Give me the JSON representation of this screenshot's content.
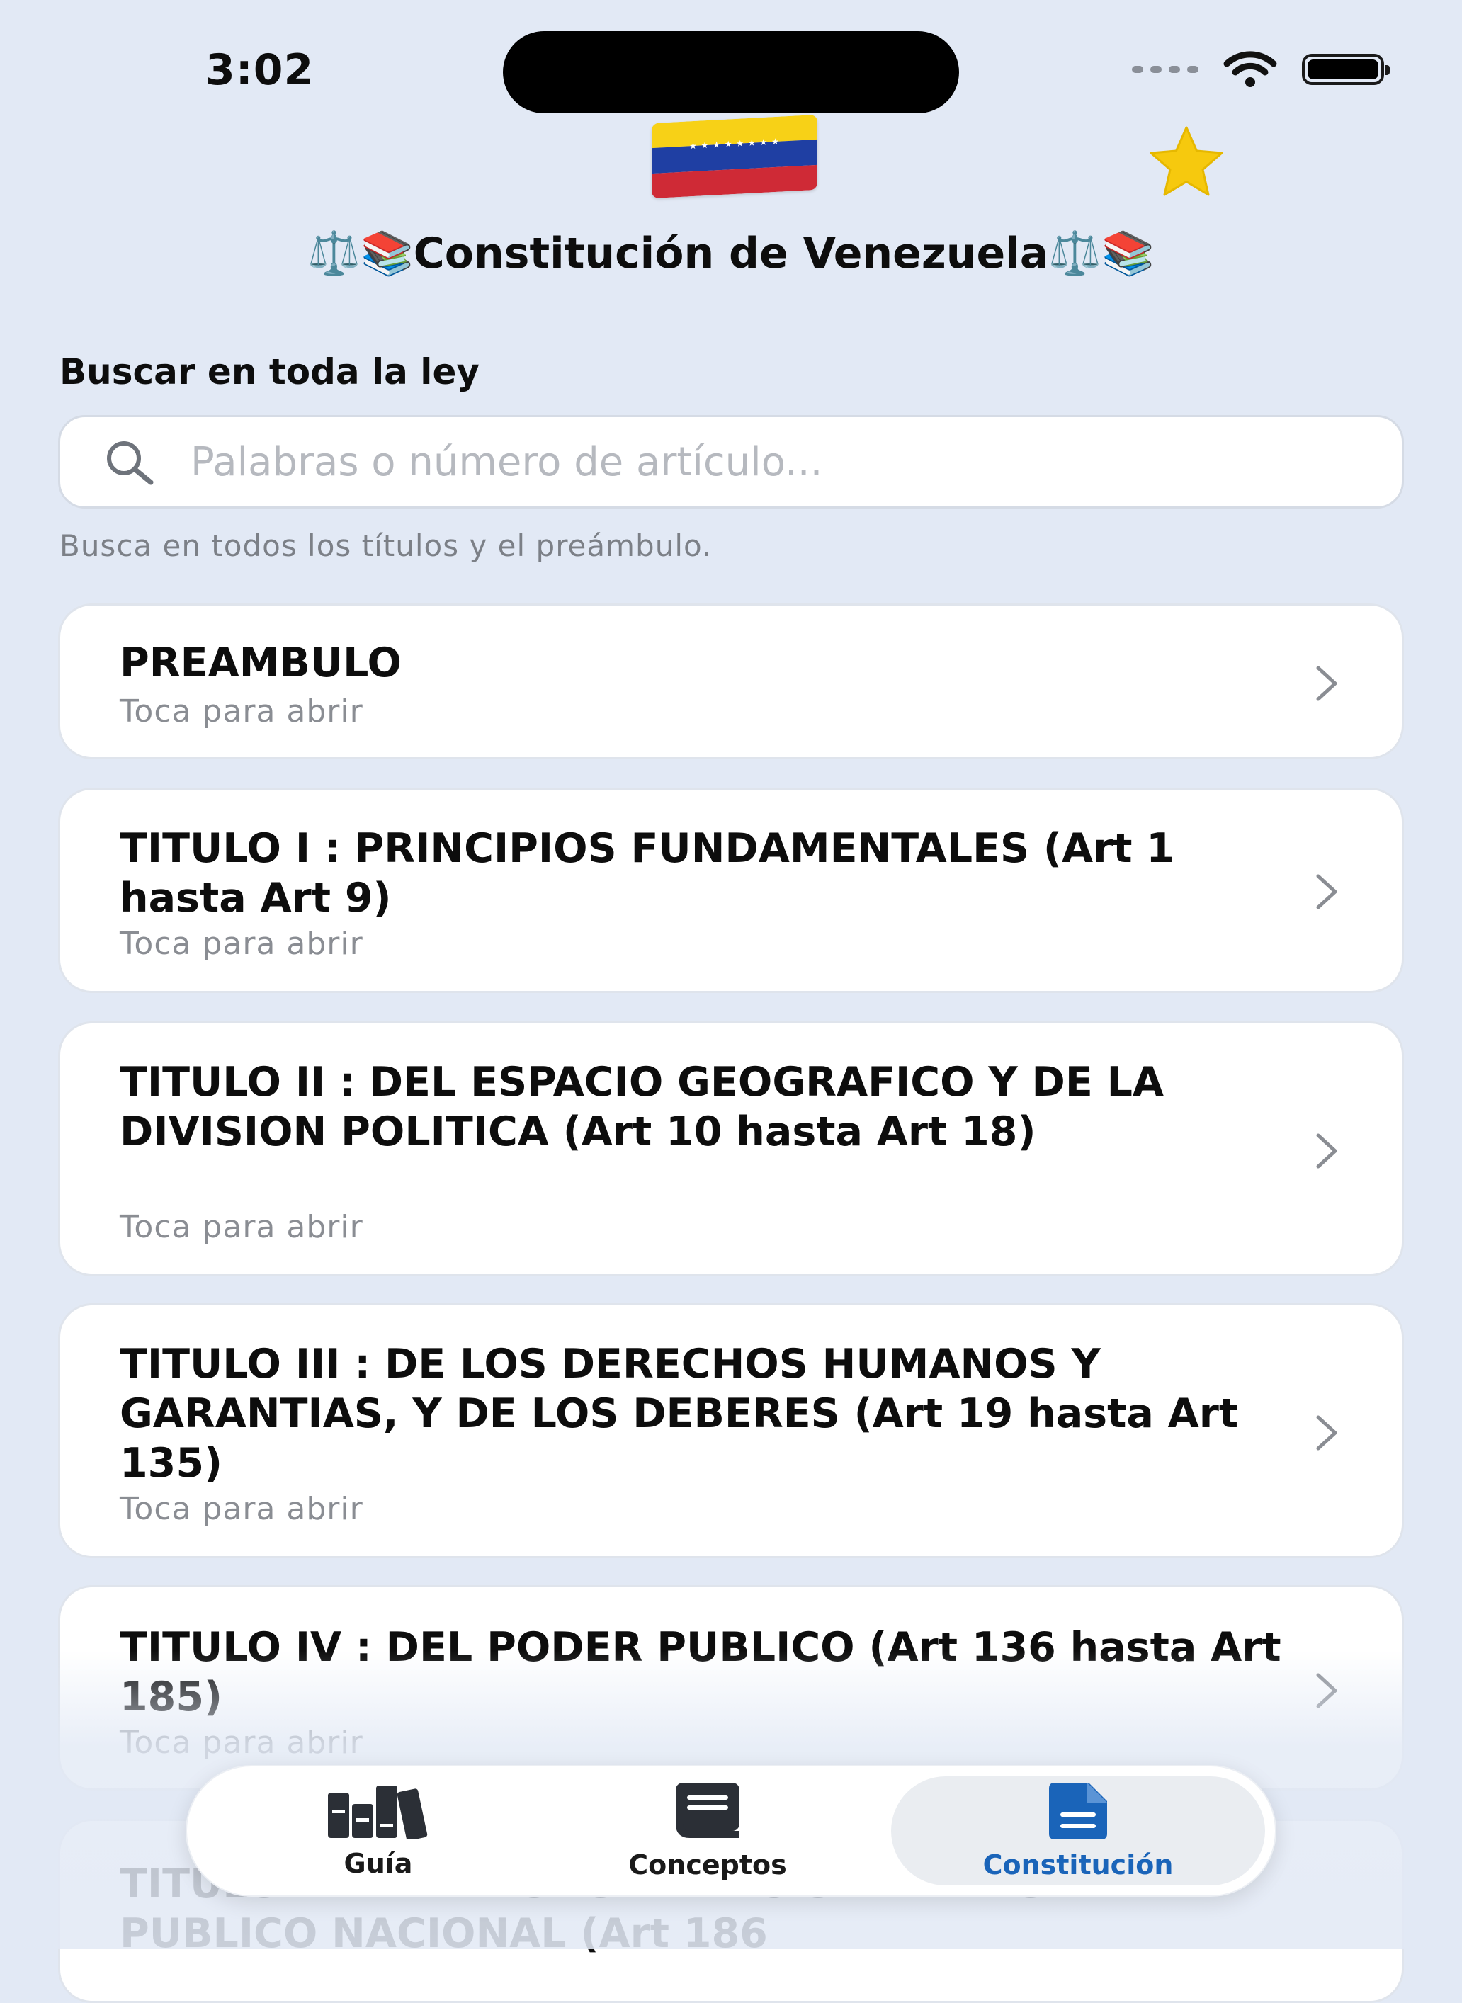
{
  "status_bar": {
    "time": "3:02"
  },
  "header": {
    "moon_icon": "moon-icon",
    "flag_icon": "venezuela-flag",
    "star_icon": "star-icon",
    "title_prefix": "⚖️📚",
    "title": "Constitución de Venezuela",
    "title_suffix": "⚖️📚"
  },
  "search": {
    "label": "Buscar en toda la ley",
    "placeholder": "Palabras o número de artículo...",
    "value": "",
    "hint": "Busca en todos los títulos y el preámbulo."
  },
  "sections": [
    {
      "title": "PREAMBULO",
      "subtitle": "Toca para abrir"
    },
    {
      "title": "TITULO I : PRINCIPIOS FUNDAMENTALES (Art 1 hasta Art 9)",
      "subtitle": "Toca para abrir"
    },
    {
      "title": "TITULO II : DEL ESPACIO GEOGRAFICO Y DE LA DIVISION POLITICA (Art 10 hasta Art 18)",
      "subtitle": "Toca para abrir"
    },
    {
      "title": "TITULO III : DE LOS DERECHOS HUMANOS Y GARANTIAS, Y DE LOS DEBERES (Art 19 hasta Art 135)",
      "subtitle": "Toca para abrir"
    },
    {
      "title": "TITULO IV : DEL PODER PUBLICO (Art 136 hasta Art 185)",
      "subtitle": "Toca para abrir"
    },
    {
      "title": "TITULO V : DE LA ORGANIZACION DEL PODER PUBLICO NACIONAL (Art 186",
      "subtitle": ""
    }
  ],
  "tabbar": {
    "tabs": [
      {
        "label": "Guía",
        "icon": "books-icon"
      },
      {
        "label": "Conceptos",
        "icon": "book-icon"
      },
      {
        "label": "Constitución",
        "icon": "document-icon",
        "selected": true
      }
    ],
    "accent": "#1a64b9"
  },
  "colors": {
    "background": "#e2e9f5",
    "card": "#ffffff",
    "accent": "#1a64b9",
    "star": "#f6c90e"
  }
}
